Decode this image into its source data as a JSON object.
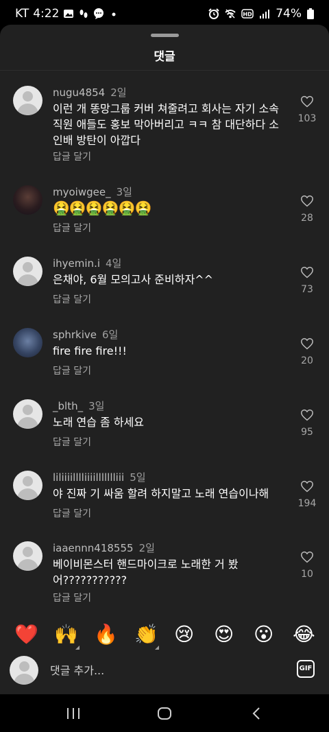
{
  "status": {
    "carrier": "KT",
    "time": "4:22",
    "battery": "74%"
  },
  "sheet": {
    "title": "댓글"
  },
  "comments": [
    {
      "username": "nugu4854",
      "ago": "2일",
      "text": "이런 개 똥망그룹 커버 쳐줄려고 회사는 자기 소속 직원 애들도 홍보 막아버리고 ㅋㅋ 참 대단하다 소인배 방탄이 아깝다",
      "reply": "답글 달기",
      "likes": "103"
    },
    {
      "username": "myoiwgee_",
      "ago": "3일",
      "text": "🤮🤮🤮🤮🤮🤮",
      "reply": "답글 달기",
      "likes": "28"
    },
    {
      "username": "ihyemin.i",
      "ago": "4일",
      "text": "은채야, 6월 모의고사 준비하자^^",
      "reply": "답글 달기",
      "likes": "73"
    },
    {
      "username": "sphrkive",
      "ago": "6일",
      "text": "fire fire fire!!!",
      "reply": "답글 달기",
      "likes": "20"
    },
    {
      "username": "_blth_",
      "ago": "3일",
      "text": "노래 연습 좀 하세요",
      "reply": "답글 달기",
      "likes": "95"
    },
    {
      "username": "liliiiilllliiiillllllliii",
      "ago": "5일",
      "text": "야 진짜 기 싸움 할려 하지말고 노래 연습이나해",
      "reply": "답글 달기",
      "likes": "194"
    },
    {
      "username": "iaaennn418555",
      "ago": "2일",
      "text": "베이비몬스터 핸드마이크로 노래한 거 봤어???????????",
      "reply": "답글 달기",
      "likes": "10"
    }
  ],
  "emoji_bar": [
    "❤️",
    "🙌",
    "🔥",
    "👏",
    "😢",
    "😍",
    "😮",
    "😂"
  ],
  "composer": {
    "placeholder": "댓글 추가...",
    "gif_label": "GIF"
  },
  "colors": {
    "sheet_bg": "#212121",
    "heart_red": "#e8325a"
  }
}
